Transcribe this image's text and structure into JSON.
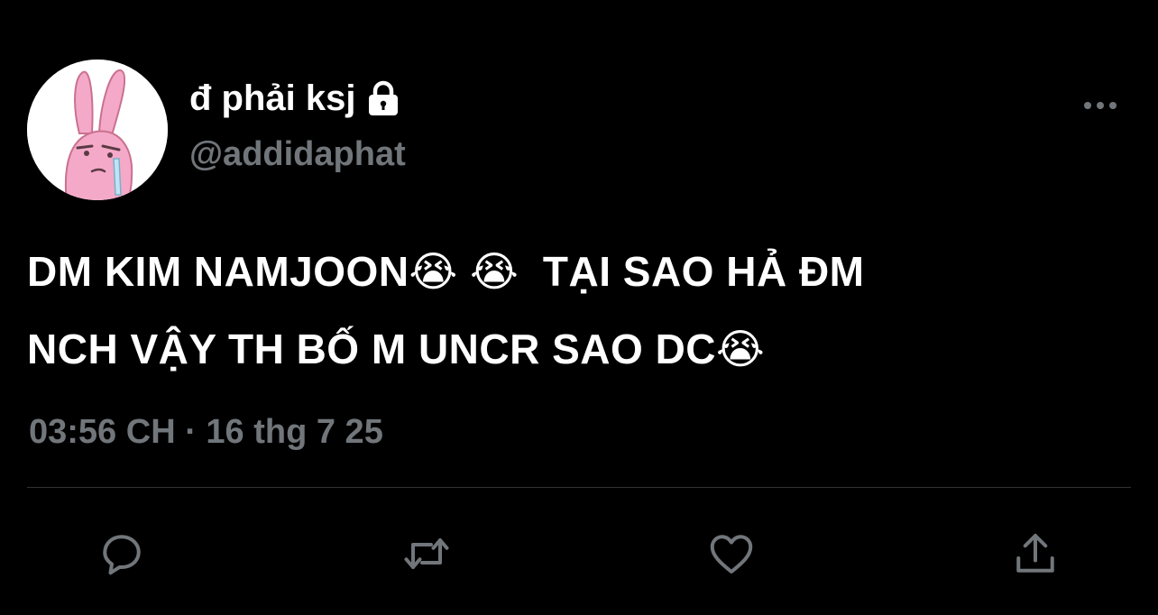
{
  "tweet": {
    "display_name": "đ phải ksj",
    "handle": "@addidaphat",
    "text_line1": "DM KIM NAMJOON😭 😭  TẠI SAO HẢ ĐM",
    "text_line2": "NCH VẬY TH BỐ M UNCR SAO DC😭",
    "timestamp": "03:56 CH · 16 thg 7 25",
    "protected": true
  },
  "icons": {
    "lock": "lock-icon",
    "more": "more-dots-icon",
    "reply": "reply-bubble-icon",
    "retweet": "retweet-icon",
    "like": "heart-icon",
    "share": "share-upload-icon"
  },
  "colors": {
    "background": "#000000",
    "primary_text": "#ffffff",
    "secondary_text": "#71767b",
    "divider": "#2f3336",
    "avatar_pink": "#f5a9c8"
  }
}
